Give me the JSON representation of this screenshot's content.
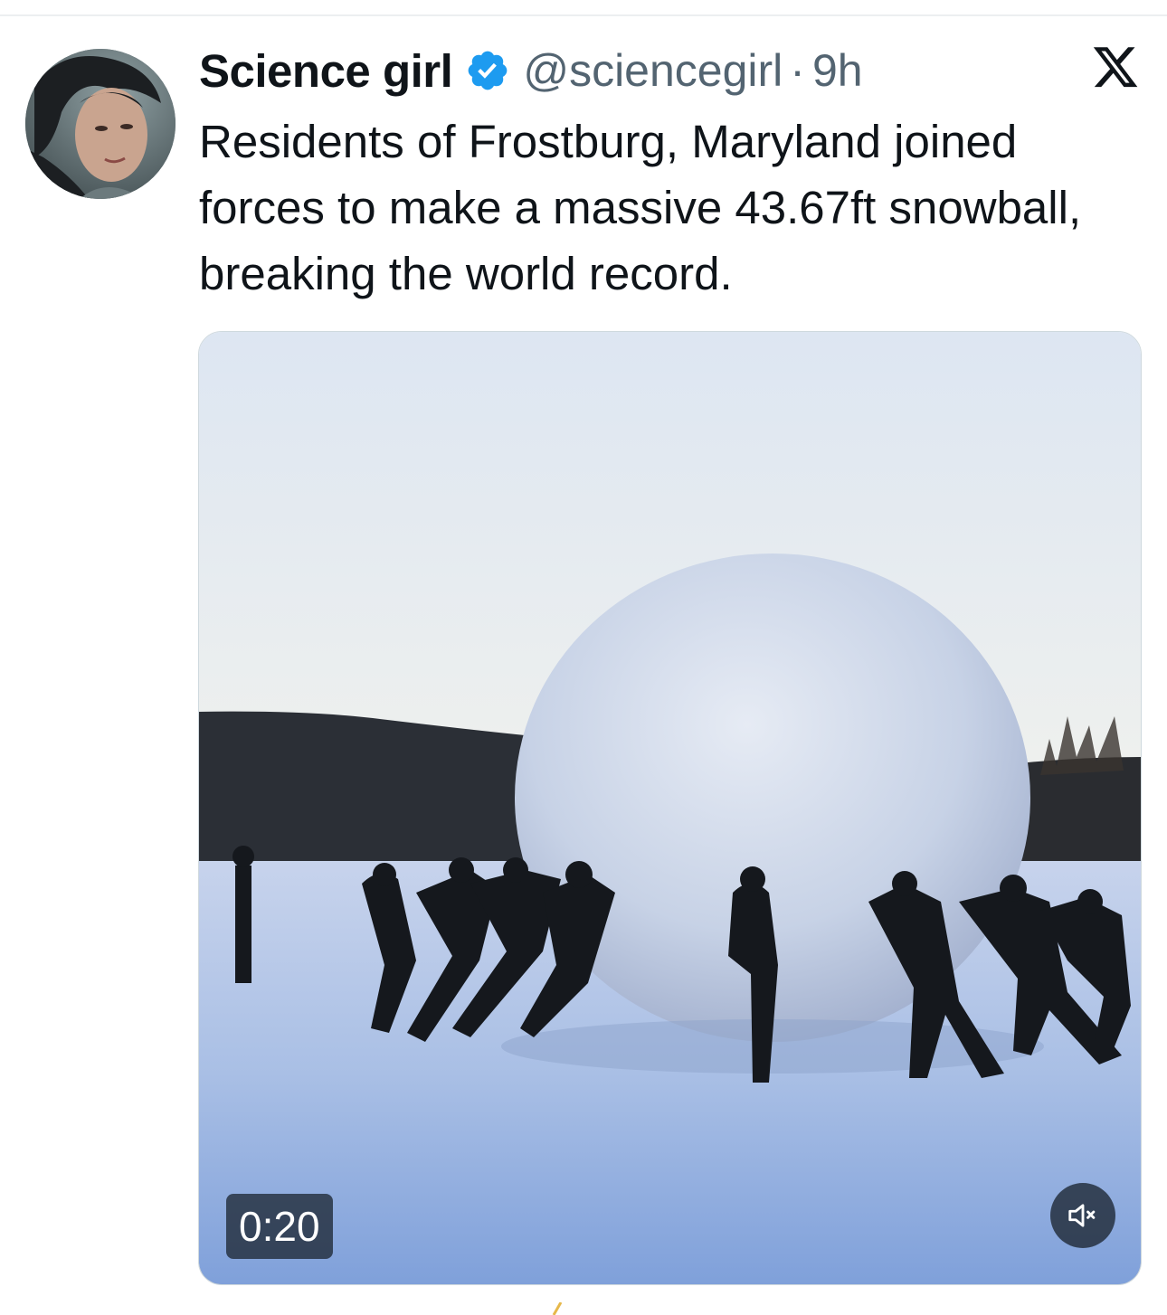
{
  "tweet": {
    "author": {
      "display_name": "Science girl",
      "verified": true,
      "handle": "@sciencegirl",
      "avatar_icon": "profile-photo"
    },
    "separator": "·",
    "timestamp": "9h",
    "platform_icon": "x-logo-icon",
    "text": "Residents of Frostburg, Maryland joined forces to make a massive 43.67ft snowball, breaking the world record.",
    "media": {
      "type": "video",
      "duration": "0:20",
      "muted": true,
      "mute_icon": "volume-muted-icon"
    }
  },
  "colors": {
    "text_primary": "#0f1419",
    "text_secondary": "#536471",
    "verified_blue": "#1d9bf0",
    "divider": "#eceff1"
  }
}
